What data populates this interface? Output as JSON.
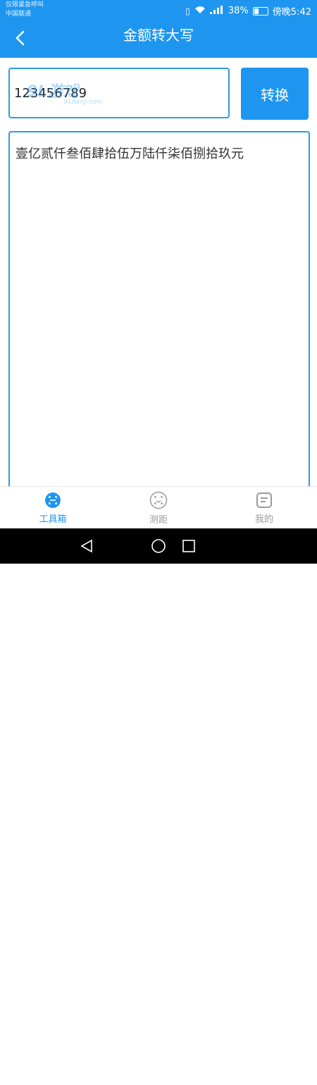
{
  "status_bar": {
    "carrier_line1": "仅限紧急呼叫",
    "carrier_line2": "中国联通",
    "battery": "38%",
    "time": "傍晚5:42"
  },
  "header": {
    "title": "金额转大写",
    "back_icon": "chevron-left-icon"
  },
  "input": {
    "value": "123456789"
  },
  "convert_button": {
    "label": "转换"
  },
  "result": {
    "text": "壹亿贰仟叁佰肆拾伍万陆仟柒佰捌拾玖元"
  },
  "tabs": [
    {
      "label": "工具箱",
      "icon": "toolbox-icon",
      "active": true
    },
    {
      "label": "测距",
      "icon": "ranging-icon",
      "active": false
    },
    {
      "label": "我的",
      "icon": "profile-icon",
      "active": false
    }
  ],
  "watermark": {
    "brand": "9L游戏",
    "url": "91danji.com"
  },
  "colors": {
    "primary": "#1E96F0",
    "border": "#2E9BE6",
    "inactive": "#9a9a9a"
  }
}
